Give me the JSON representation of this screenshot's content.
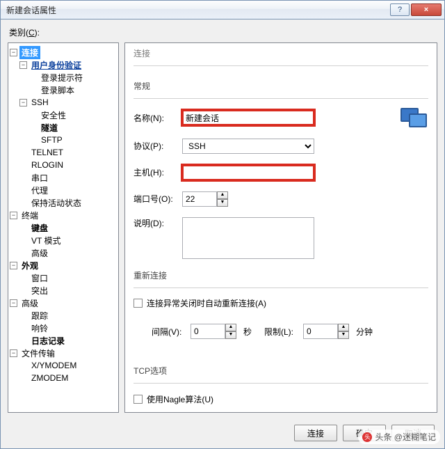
{
  "window": {
    "title": "新建会话属性",
    "help": "?",
    "close": "×"
  },
  "category_label": "类别(C):",
  "tree": {
    "connection": "连接",
    "auth": "用户身份验证",
    "login_prompt": "登录提示符",
    "login_script": "登录脚本",
    "ssh": "SSH",
    "security": "安全性",
    "tunnel": "隧道",
    "sftp": "SFTP",
    "telnet": "TELNET",
    "rlogin": "RLOGIN",
    "serial": "串口",
    "proxy": "代理",
    "keepalive": "保持活动状态",
    "terminal": "终端",
    "keyboard": "键盘",
    "vt": "VT 模式",
    "advanced_t": "高级",
    "appearance": "外观",
    "window_n": "窗口",
    "highlight": "突出",
    "advanced": "高级",
    "trace": "跟踪",
    "bell": "响铃",
    "log": "日志记录",
    "file_transfer": "文件传输",
    "xymodem": "X/YMODEM",
    "zmodem": "ZMODEM"
  },
  "right": {
    "header": "连接",
    "general": "常规",
    "name_label": "名称(N):",
    "name_value": "新建会话",
    "protocol_label": "协议(P):",
    "protocol_value": "SSH",
    "host_label": "主机(H):",
    "host_value": "",
    "port_label": "端口号(O):",
    "port_value": "22",
    "desc_label": "说明(D):",
    "desc_value": "",
    "reconnect_header": "重新连接",
    "reconnect_cb": "连接异常关闭时自动重新连接(A)",
    "interval_label": "间隔(V):",
    "interval_value": "0",
    "interval_unit": "秒",
    "limit_label": "限制(L):",
    "limit_value": "0",
    "limit_unit": "分钟",
    "tcp_header": "TCP选项",
    "nagle_cb": "使用Nagle算法(U)"
  },
  "buttons": {
    "connect": "连接",
    "ok": "确定",
    "cancel": "取消"
  },
  "watermark": "头条 @迷糊笔记"
}
